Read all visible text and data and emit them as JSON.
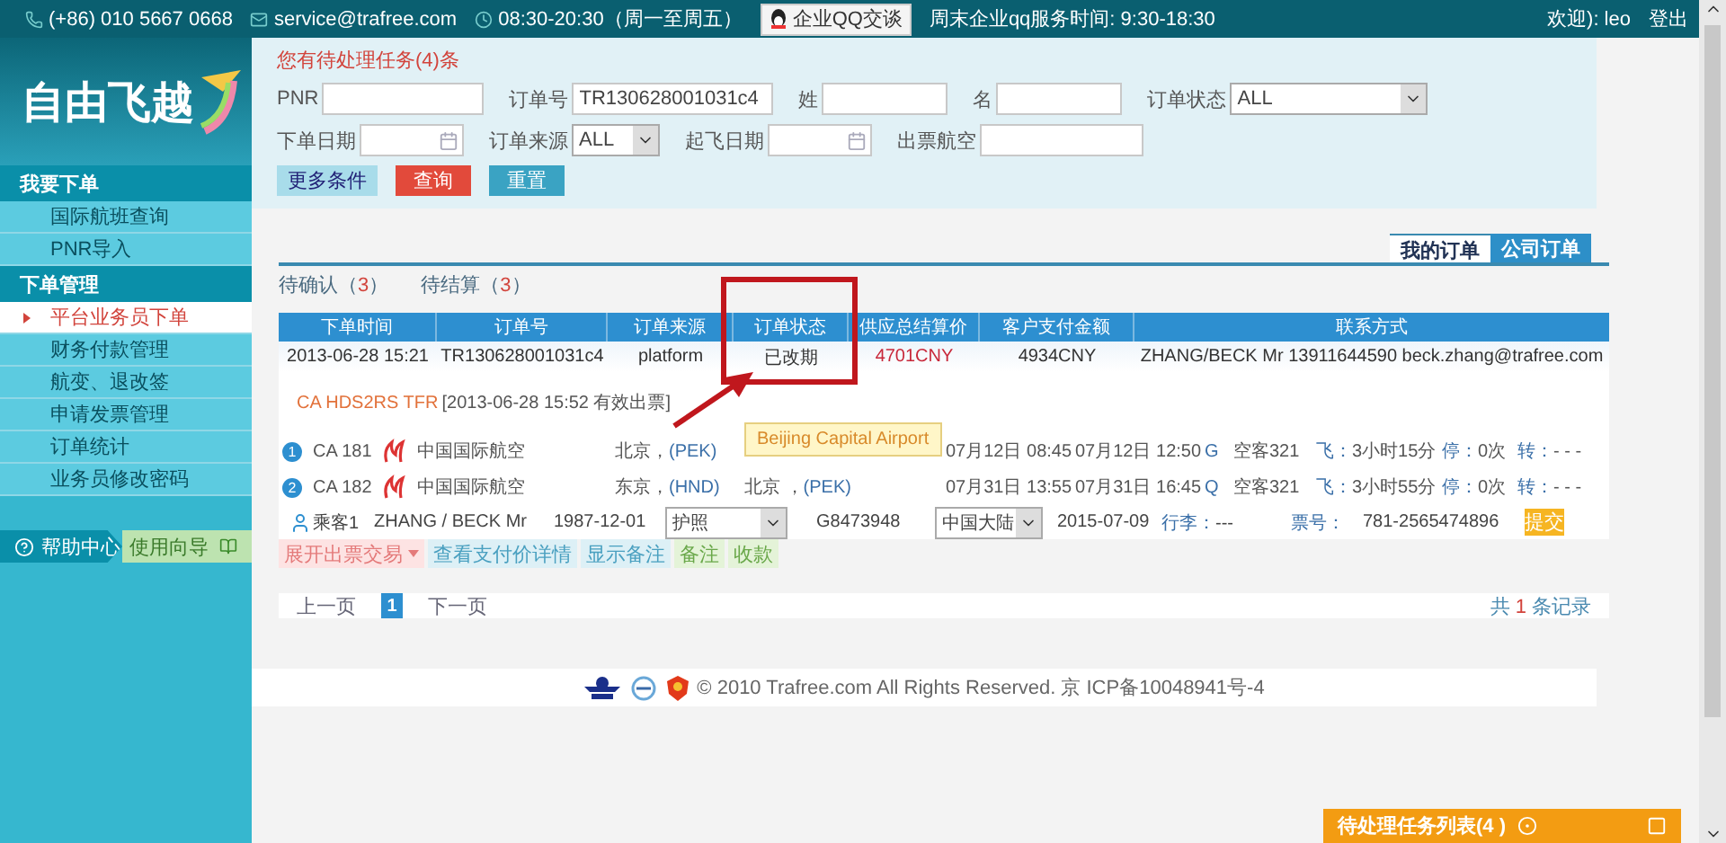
{
  "top_bar": {
    "phone": "(+86) 010 5667 0668",
    "email": "service@trafree.com",
    "hours": "08:30-20:30（周一至周五）",
    "qq_button": "企业QQ交谈",
    "weekend_hours": "周末企业qq服务时间: 9:30-18:30",
    "welcome": "欢迎): leo",
    "logout": "登出"
  },
  "sidebar": {
    "logo": "自由飞越",
    "sections": [
      {
        "title": "我要下单",
        "items": [
          {
            "label": "国际航班查询",
            "selected": false
          },
          {
            "label": "PNR导入",
            "selected": false
          }
        ]
      },
      {
        "title": "下单管理",
        "items": [
          {
            "label": "平台业务员下单",
            "selected": true
          },
          {
            "label": "财务付款管理",
            "selected": false
          },
          {
            "label": "航变、退改签",
            "selected": false
          },
          {
            "label": "申请发票管理",
            "selected": false
          },
          {
            "label": "订单统计",
            "selected": false
          },
          {
            "label": "业务员修改密码",
            "selected": false
          }
        ]
      }
    ],
    "help": "帮助中心",
    "guide": "使用向导"
  },
  "notice": "您有待处理任务(4)条",
  "search": {
    "rows": [
      {
        "fields": [
          {
            "label": "PNR",
            "kind": "text"
          },
          {
            "label": "订单号",
            "kind": "text",
            "value": "TR130628001031c4"
          },
          {
            "label": "姓",
            "kind": "text"
          },
          {
            "label": "名",
            "kind": "text"
          },
          {
            "label": "订单状态",
            "kind": "select",
            "value": "ALL"
          }
        ]
      },
      {
        "fields": [
          {
            "label": "下单日期",
            "kind": "date"
          },
          {
            "label": "订单来源",
            "kind": "select",
            "value": "ALL"
          },
          {
            "label": "起飞日期",
            "kind": "date"
          },
          {
            "label": "出票航空",
            "kind": "text"
          }
        ]
      }
    ],
    "buttons": [
      {
        "label": "更多条件",
        "kind": "more"
      },
      {
        "label": "查询",
        "kind": "search"
      },
      {
        "label": "重置",
        "kind": "reset"
      }
    ]
  },
  "tabs": [
    {
      "label": "我的订单",
      "selected": true
    },
    {
      "label": "公司订单",
      "selected": false
    }
  ],
  "subtabs": [
    {
      "label": "待确认（",
      "count": "3",
      "close": "）"
    },
    {
      "label": "待结算（",
      "count": "3",
      "close": "）"
    }
  ],
  "orders": {
    "columns": [
      "下单时间",
      "订单号",
      "订单来源",
      "订单状态",
      "供应总结算价",
      "客户支付金额",
      "联系方式"
    ],
    "row": {
      "time": "2013-06-28 15:21",
      "order_no": "TR130628001031c4",
      "source": "platform",
      "status": "已改期",
      "supplier_price": "4701CNY",
      "customer_price": "4934CNY",
      "contact": "ZHANG/BECK Mr 13911644590 beck.zhang@trafree.com"
    },
    "pnr": "CA HDS2RS TFR",
    "issued": "[2013-06-28 15:52 有效出票]",
    "segments": [
      {
        "index": "1",
        "flight": "CA 181",
        "airline": "中国国际航空",
        "from": "北京，",
        "from_code": "(PEK)",
        "dep": "07月12日 08:45",
        "arr": "07月12日 12:50",
        "cabin": "G",
        "aircraft": "空客321",
        "fly_label": "飞：",
        "fly": "3小时15分",
        "stop_label": "停：",
        "stop": "0次",
        "transfer_label": "转：",
        "transfer": "- - -",
        "tooltip": "Beijing Capital Airport"
      },
      {
        "index": "2",
        "flight": "CA 182",
        "airline": "中国国际航空",
        "from": "东京，",
        "from_code": "(HND)",
        "to": "北京 ，",
        "to_code": "(PEK)",
        "dep": "07月31日 13:55",
        "arr": "07月31日 16:45",
        "cabin": "Q",
        "aircraft": "空客321",
        "fly_label": "飞：",
        "fly": "3小时55分",
        "stop_label": "停：",
        "stop": "0次",
        "transfer_label": "转：",
        "transfer": "- - -"
      }
    ],
    "passenger": {
      "label": "乘客1",
      "name": "ZHANG / BECK Mr",
      "birth": "1987-12-01",
      "id_type": "护照",
      "id_number": "G8473948",
      "nationality": "中国大陆",
      "expiry": "2015-07-09",
      "baggage_label": "行李：",
      "baggage": "---",
      "ticket_label": "票号：",
      "ticket": "781-2565474896",
      "submit": "提交"
    },
    "actions": [
      {
        "label": "展开出票交易",
        "kind": "expand"
      },
      {
        "label": "查看支付价详情",
        "kind": "info"
      },
      {
        "label": "显示备注",
        "kind": "info"
      },
      {
        "label": "备注",
        "kind": "note"
      },
      {
        "label": "收款",
        "kind": "note"
      }
    ]
  },
  "pagination": {
    "prev": "上一页",
    "pages": [
      {
        "label": "1",
        "selected": true
      }
    ],
    "next": "下一页",
    "total_prefix": "共",
    "total": "1",
    "total_suffix": "条记录"
  },
  "footer": "© 2010 Trafree.com All Rights Reserved. 京 ICP备10048941号-4",
  "task_bar": {
    "title": "待处理任务列表(4 )"
  }
}
